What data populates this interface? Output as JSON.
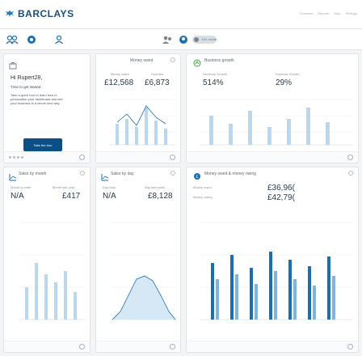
{
  "app": {
    "brand": "BARCLAYS"
  },
  "topnav": {
    "items": [
      "Overview",
      "Reports",
      "Help",
      "Settings"
    ]
  },
  "toolbar": {
    "toggle_label": "Ext. mode"
  },
  "welcome": {
    "greeting": "Hi Rupert28,",
    "subtitle": "Time to get started",
    "body": "Take a quick tour to learn how to personalise your dashboard and see your business in a whole new way.",
    "button": "Take the tour"
  },
  "money_owed": {
    "title": "Money owed",
    "left_value": "£12,568",
    "right_value": "£6,873",
    "left_caption": "Money owed",
    "right_caption": "Overdue"
  },
  "business_growth": {
    "title": "Business growth",
    "left_value": "514%",
    "right_value": "29%",
    "left_caption": "Revenue Growth",
    "right_caption": "Expense Growth"
  },
  "sales_by_month": {
    "title": "Sales by month",
    "left_caption": "Month-to-date",
    "right_caption": "Month last year",
    "left_value": "N/A",
    "right_value": "£417"
  },
  "sales_by_day": {
    "title": "Sales by day",
    "left_caption": "Day total",
    "right_caption": "Day last week",
    "left_value": "N/A",
    "right_value": "£8,128"
  },
  "money_owed_vs": {
    "title": "Money owed & money owing",
    "row1_caption": "Money owed",
    "row1_value": "£36,96(",
    "row2_caption": "Money owing",
    "row2_value": "£42,79("
  },
  "colors": {
    "brand": "#00aeef",
    "accent_blue": "#1a6fb0",
    "accent_green": "#3fa63f",
    "button": "#0a4f86"
  }
}
